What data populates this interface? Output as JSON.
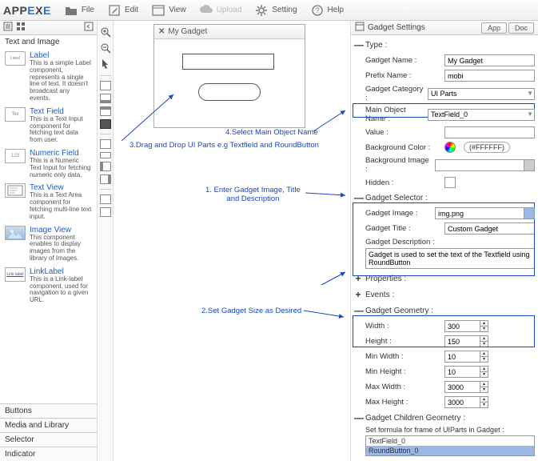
{
  "menubar": {
    "logo_pre": "APP",
    "logo_e1": "E",
    "logo_mid": "X",
    "logo_e2": "E",
    "items": [
      {
        "label": "File"
      },
      {
        "label": "Edit"
      },
      {
        "label": "View"
      },
      {
        "label": "Upload"
      },
      {
        "label": "Setting"
      },
      {
        "label": "Help"
      }
    ]
  },
  "palette": {
    "section_title": "Text and Image",
    "items": [
      {
        "title": "Label",
        "thumb": "Label",
        "desc": "This is a simple Label component, represents a single line of text. It doesn't broadcast any events."
      },
      {
        "title": "Text Field",
        "thumb": "Tex",
        "desc": "This is a Text Input component for fetching text data from user."
      },
      {
        "title": "Numeric Field",
        "thumb": "123",
        "desc": "This is a Numeric Text Input for fetching numeric only data."
      },
      {
        "title": "Text View",
        "thumb": "",
        "desc": "This is a Text Area component for fetching multi-line text input."
      },
      {
        "title": "Image View",
        "thumb": "",
        "desc": "This component enables to display images from the library of Images."
      },
      {
        "title": "LinkLabel",
        "thumb": "Link label",
        "desc": "This is a Link-label component, used for navigation to a given URL."
      }
    ],
    "accordion": [
      "Buttons",
      "Media and Library",
      "Selector",
      "Indicator"
    ]
  },
  "canvas": {
    "gadget_title": "My Gadget",
    "anno3": "3.Drag and Drop UI Parts e.g Textfield and RoundButton",
    "anno4": "4.Select Main Object Name",
    "anno1a": "1. Enter Gadget Image, Title",
    "anno1b": "and Description",
    "anno2": "2.Set Gadget Size as Desired"
  },
  "settings": {
    "title": "Gadget Settings",
    "tab_app": "App",
    "tab_doc": "Doc",
    "sect_type": "Type  :",
    "type": {
      "gadget_name_l": "Gadget Name :",
      "gadget_name_v": "My Gadget",
      "prefix_l": "Prefix Name :",
      "prefix_v": "mobi",
      "category_l": "Gadget Category :",
      "category_v": "UI Parts",
      "mainobj_l": "Main Object Name :",
      "mainobj_v": "TextField_0",
      "value_l": "Value :",
      "value_v": "",
      "bgcolor_l": "Background Color :",
      "bgcolor_v": "(#FFFFFF)",
      "bgimage_l": "Background Image :",
      "hidden_l": "Hidden :"
    },
    "sect_selector": "Gadget Selector :",
    "selector": {
      "image_l": "Gadget Image :",
      "image_v": "img.png",
      "title_l": "Gadget Title :",
      "title_v": "Custom Gadget",
      "desc_l": "Gadget Description :",
      "desc_v": "Gadget is used to set the text of the Textfield using RoundButton"
    },
    "sect_properties": "Properties :",
    "sect_events": "Events :",
    "sect_geometry": "Gadget Geometry :",
    "geometry": {
      "width_l": "Width :",
      "width_v": "300",
      "height_l": "Height :",
      "height_v": "150",
      "minw_l": "Min Width :",
      "minw_v": "10",
      "minh_l": "Min Height :",
      "minh_v": "10",
      "maxw_l": "Max Width :",
      "maxw_v": "3000",
      "maxh_l": "Max Height :",
      "maxh_v": "3000"
    },
    "sect_children": "Gadget Children Geometry :",
    "children_label": "Set formula for frame of UIParts in Gadget :",
    "children": [
      "TextField_0",
      "RoundButton_0"
    ]
  }
}
